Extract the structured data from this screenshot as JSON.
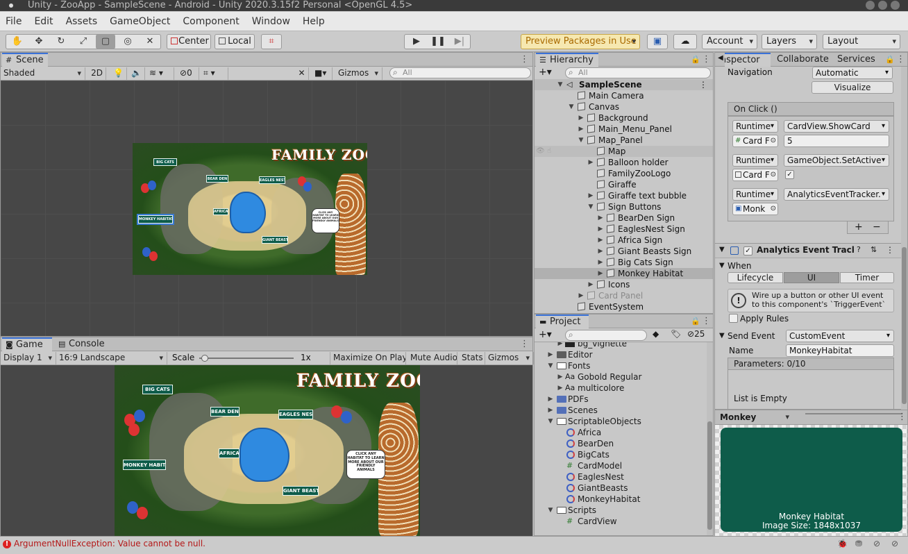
{
  "window": {
    "title": "Unity - ZooApp - SampleScene - Android - Unity 2020.3.15f2 Personal <OpenGL 4.5>"
  },
  "menu": [
    "File",
    "Edit",
    "Assets",
    "GameObject",
    "Component",
    "Window",
    "Help"
  ],
  "toolbar": {
    "pivot": "Center",
    "space": "Local",
    "preview_packages": "Preview Packages in Use",
    "account": "Account",
    "layers": "Layers",
    "layout": "Layout"
  },
  "scene": {
    "tab": "Scene",
    "shading": "Shaded",
    "mode_2d": "2D",
    "hidden_count": "0",
    "gizmos": "Gizmos",
    "search_placeholder": "All"
  },
  "map": {
    "title": "FAMILY ZOO",
    "signs": {
      "big_cats": "BIG CATS",
      "bear_den": "BEAR DEN",
      "eagles_nest": "EAGLES NEST",
      "africa": "AFRICA",
      "giant_beasts": "GIANT BEASTS",
      "monkey_habitat": "MONKEY HABITAT"
    },
    "bubble": "CLICK ANY HABITAT TO LEARN MORE ABOUT OUR FRIENDLY ANIMALS"
  },
  "game": {
    "tab_game": "Game",
    "tab_console": "Console",
    "display": "Display 1",
    "aspect": "16:9 Landscape",
    "scale_label": "Scale",
    "scale_value": "1x",
    "maximize": "Maximize On Play",
    "mute": "Mute Audio",
    "stats": "Stats",
    "gizmos": "Gizmos",
    "scale_fraction": 0.02
  },
  "hierarchy": {
    "tab": "Hierarchy",
    "search_placeholder": "All",
    "scene_name": "SampleScene",
    "items": [
      {
        "label": "Main Camera"
      },
      {
        "label": "Canvas"
      },
      {
        "label": "Background"
      },
      {
        "label": "Main_Menu_Panel"
      },
      {
        "label": "Map_Panel"
      },
      {
        "label": "Map"
      },
      {
        "label": "Balloon holder"
      },
      {
        "label": "FamilyZooLogo"
      },
      {
        "label": "Giraffe"
      },
      {
        "label": "Giraffe text bubble"
      },
      {
        "label": "Sign Buttons"
      },
      {
        "label": "BearDen Sign"
      },
      {
        "label": "EaglesNest Sign"
      },
      {
        "label": "Africa Sign"
      },
      {
        "label": "Giant Beasts Sign"
      },
      {
        "label": "Big Cats Sign"
      },
      {
        "label": "Monkey Habitat"
      },
      {
        "label": "Icons"
      },
      {
        "label": "Card Panel"
      },
      {
        "label": "EventSystem"
      }
    ]
  },
  "project": {
    "tab": "Project",
    "hidden_count": "25",
    "items": [
      {
        "label": "bg_vignette"
      },
      {
        "label": "Editor"
      },
      {
        "label": "Fonts"
      },
      {
        "label": "Gobold Regular"
      },
      {
        "label": "multicolore"
      },
      {
        "label": "PDFs"
      },
      {
        "label": "Scenes"
      },
      {
        "label": "ScriptableObjects"
      },
      {
        "label": "Africa"
      },
      {
        "label": "BearDen"
      },
      {
        "label": "BigCats"
      },
      {
        "label": "CardModel"
      },
      {
        "label": "EaglesNest"
      },
      {
        "label": "GiantBeasts"
      },
      {
        "label": "MonkeyHabitat"
      },
      {
        "label": "Scripts"
      },
      {
        "label": "CardView"
      }
    ]
  },
  "inspector": {
    "tabs": [
      "Inspector",
      "Collaborate",
      "Services"
    ],
    "navigation_label": "Navigation",
    "navigation_value": "Automatic",
    "visualize": "Visualize",
    "on_click_header": "On Click ()",
    "events": [
      {
        "mode": "Runtime",
        "function": "CardView.ShowCard",
        "object": "Card F",
        "arg": "5"
      },
      {
        "mode": "Runtime",
        "function": "GameObject.SetActive",
        "object": "Card F",
        "arg": "✓"
      },
      {
        "mode": "Runtime",
        "function": "AnalyticsEventTracker.",
        "object": "Monk",
        "arg": ""
      }
    ],
    "component_title": "Analytics Event Tracker",
    "when_label": "When",
    "when_options": [
      "Lifecycle",
      "UI",
      "Timer"
    ],
    "help_text": "Wire up a button or other UI event to this component's `TriggerEvent`",
    "apply_rules": "Apply Rules",
    "send_event_label": "Send Event",
    "send_event_value": "CustomEvent",
    "name_label": "Name",
    "name_value": "MonkeyHabitat",
    "parameters": "Parameters: 0/10",
    "list_empty": "List is Empty"
  },
  "preview": {
    "title": "Monkey Habitat",
    "caption_name": "Monkey Habitat",
    "caption_size": "Image Size: 1848x1037",
    "color": "#0e5c4a"
  },
  "status": {
    "error": "ArgumentNullException: Value cannot be null."
  }
}
